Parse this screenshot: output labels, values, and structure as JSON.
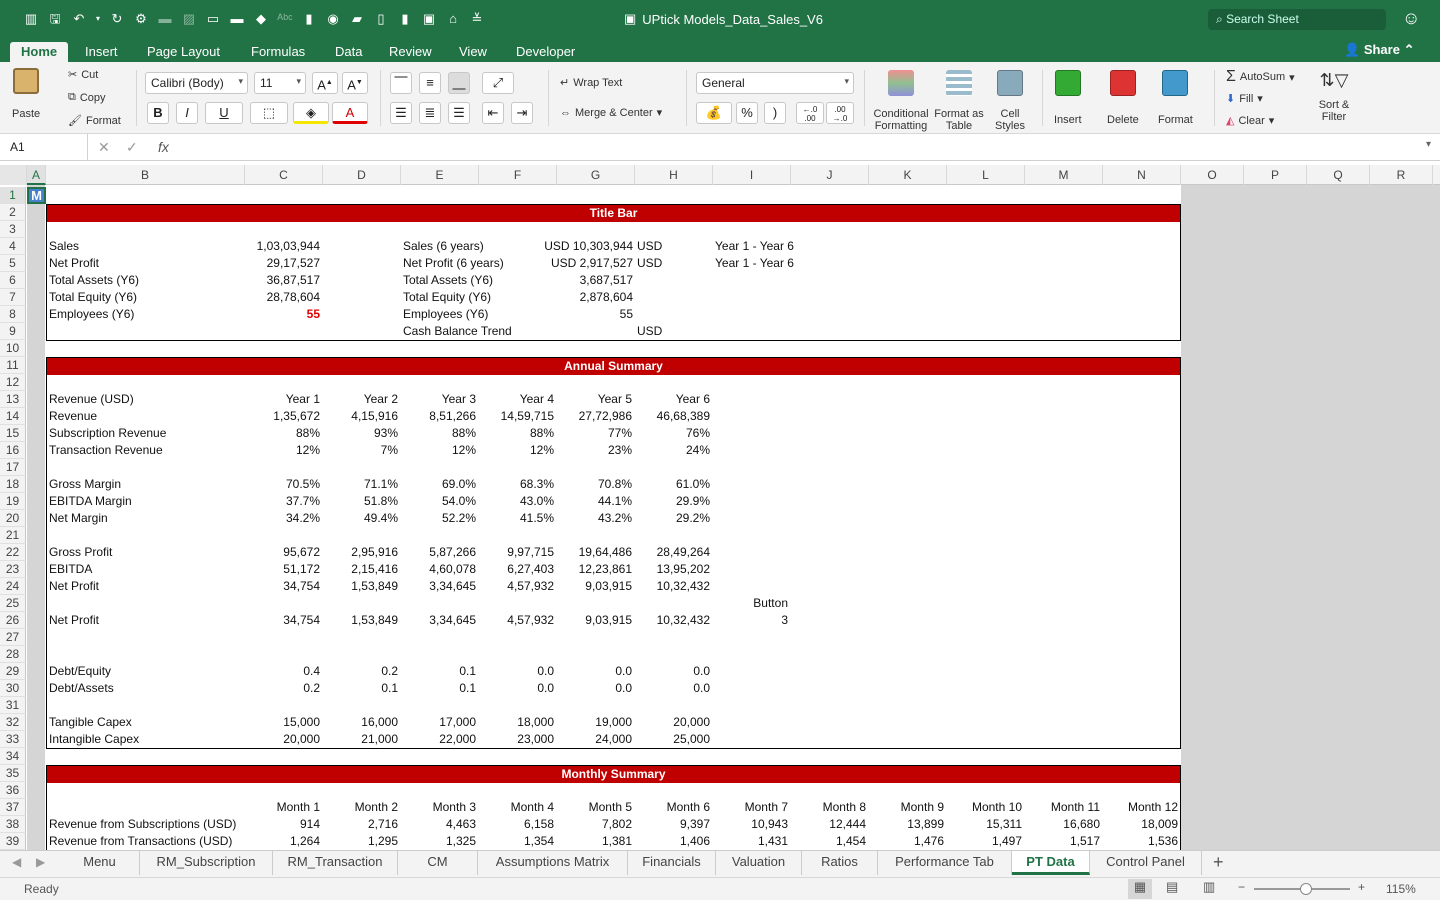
{
  "app": {
    "doc_title": "UPtick Models_Data_Sales_V6",
    "search_placeholder": "Search Sheet",
    "share_label": "Share"
  },
  "ribbon_tabs": [
    "Home",
    "Insert",
    "Page Layout",
    "Formulas",
    "Data",
    "Review",
    "View",
    "Developer"
  ],
  "ribbon": {
    "paste": "Paste",
    "cut": "Cut",
    "copy": "Copy",
    "format": "Format",
    "font_name": "Calibri (Body)",
    "font_size": "11",
    "bold": "B",
    "italic": "I",
    "underline": "U",
    "wrap_text": "Wrap Text",
    "merge_center": "Merge & Center",
    "number_format": "General",
    "percent": "%",
    "comma": ")",
    "inc_decimal": "←.0\n.00",
    "dec_decimal": ".00\n→.0",
    "conditional_formatting": "Conditional Formatting",
    "format_as_table": "Format as Table",
    "cell_styles": "Cell Styles",
    "insert": "Insert",
    "delete": "Delete",
    "format_cells": "Format",
    "autosum": "AutoSum",
    "fill": "Fill",
    "clear": "Clear",
    "sort_filter": "Sort & Filter"
  },
  "formula_bar": {
    "name_box": "A1",
    "fx": "fx",
    "value": ""
  },
  "columns": [
    "A",
    "B",
    "C",
    "D",
    "E",
    "F",
    "G",
    "H",
    "I",
    "J",
    "K",
    "L",
    "M",
    "N",
    "O",
    "P",
    "Q",
    "R"
  ],
  "rows": [
    "1",
    "2",
    "3",
    "4",
    "5",
    "6",
    "7",
    "8",
    "9",
    "10",
    "11",
    "12",
    "13",
    "14",
    "15",
    "16",
    "17",
    "18",
    "19",
    "20",
    "21",
    "22",
    "23",
    "24",
    "25",
    "26",
    "27",
    "28",
    "29",
    "30",
    "31",
    "32",
    "33",
    "34",
    "35",
    "36",
    "37",
    "38",
    "39"
  ],
  "a1_value": "M",
  "title_block": {
    "header": "Title Bar",
    "left": [
      [
        "Sales",
        "1,03,03,944"
      ],
      [
        "Net Profit",
        "29,17,527"
      ],
      [
        "Total Assets (Y6)",
        "36,87,517"
      ],
      [
        "Total Equity (Y6)",
        "28,78,604"
      ],
      [
        "Employees (Y6)",
        "55"
      ]
    ],
    "mid": [
      [
        "Sales (6 years)",
        "USD 10,303,944",
        "USD"
      ],
      [
        "Net Profit (6 years)",
        "USD 2,917,527",
        "USD"
      ],
      [
        "Total Assets (Y6)",
        "3,687,517",
        ""
      ],
      [
        "Total Equity (Y6)",
        "2,878,604",
        ""
      ],
      [
        "Employees (Y6)",
        "55",
        ""
      ],
      [
        "Cash Balance Trend",
        "",
        "USD"
      ]
    ],
    "right": [
      "Year 1 - Year 6",
      "Year 1 - Year 6"
    ]
  },
  "annual": {
    "header": "Annual Summary",
    "col_label": "Revenue (USD)",
    "years": [
      "Year 1",
      "Year 2",
      "Year 3",
      "Year 4",
      "Year 5",
      "Year 6"
    ],
    "rows": [
      {
        "r": 14,
        "label": "Revenue",
        "v": [
          "1,35,672",
          "4,15,916",
          "8,51,266",
          "14,59,715",
          "27,72,986",
          "46,68,389"
        ]
      },
      {
        "r": 15,
        "label": "Subscription Revenue",
        "v": [
          "88%",
          "93%",
          "88%",
          "88%",
          "77%",
          "76%"
        ]
      },
      {
        "r": 16,
        "label": "Transaction Revenue",
        "v": [
          "12%",
          "7%",
          "12%",
          "12%",
          "23%",
          "24%"
        ]
      },
      {
        "r": 18,
        "label": "Gross Margin",
        "v": [
          "70.5%",
          "71.1%",
          "69.0%",
          "68.3%",
          "70.8%",
          "61.0%"
        ]
      },
      {
        "r": 19,
        "label": "EBITDA Margin",
        "v": [
          "37.7%",
          "51.8%",
          "54.0%",
          "43.0%",
          "44.1%",
          "29.9%"
        ]
      },
      {
        "r": 20,
        "label": "Net Margin",
        "v": [
          "34.2%",
          "49.4%",
          "52.2%",
          "41.5%",
          "43.2%",
          "29.2%"
        ]
      },
      {
        "r": 22,
        "label": "Gross Profit",
        "v": [
          "95,672",
          "2,95,916",
          "5,87,266",
          "9,97,715",
          "19,64,486",
          "28,49,264"
        ]
      },
      {
        "r": 23,
        "label": "EBITDA",
        "v": [
          "51,172",
          "2,15,416",
          "4,60,078",
          "6,27,403",
          "12,23,861",
          "13,95,202"
        ]
      },
      {
        "r": 24,
        "label": "Net Profit",
        "v": [
          "34,754",
          "1,53,849",
          "3,34,645",
          "4,57,932",
          "9,03,915",
          "10,32,432"
        ]
      },
      {
        "r": 26,
        "label": "Net Profit",
        "v": [
          "34,754",
          "1,53,849",
          "3,34,645",
          "4,57,932",
          "9,03,915",
          "10,32,432"
        ]
      },
      {
        "r": 29,
        "label": "Debt/Equity",
        "v": [
          "0.4",
          "0.2",
          "0.1",
          "0.0",
          "0.0",
          "0.0"
        ]
      },
      {
        "r": 30,
        "label": "Debt/Assets",
        "v": [
          "0.2",
          "0.1",
          "0.1",
          "0.0",
          "0.0",
          "0.0"
        ]
      },
      {
        "r": 32,
        "label": "Tangible Capex",
        "v": [
          "15,000",
          "16,000",
          "17,000",
          "18,000",
          "19,000",
          "20,000"
        ]
      },
      {
        "r": 33,
        "label": "Intangible Capex",
        "v": [
          "20,000",
          "21,000",
          "22,000",
          "23,000",
          "24,000",
          "25,000"
        ]
      }
    ],
    "button_label": "Button",
    "button_value": "3"
  },
  "monthly": {
    "header": "Monthly Summary",
    "months": [
      "Month 1",
      "Month 2",
      "Month 3",
      "Month 4",
      "Month 5",
      "Month 6",
      "Month 7",
      "Month 8",
      "Month 9",
      "Month 10",
      "Month 11",
      "Month 12"
    ],
    "rows": [
      {
        "r": 38,
        "label": "Revenue from Subscriptions (USD)",
        "v": [
          "914",
          "2,716",
          "4,463",
          "6,158",
          "7,802",
          "9,397",
          "10,943",
          "12,444",
          "13,899",
          "15,311",
          "16,680",
          "18,009"
        ]
      },
      {
        "r": 39,
        "label": "Revenue from Transactions (USD)",
        "v": [
          "1,264",
          "1,295",
          "1,325",
          "1,354",
          "1,381",
          "1,406",
          "1,431",
          "1,454",
          "1,476",
          "1,497",
          "1,517",
          "1,536"
        ]
      }
    ]
  },
  "sheet_tabs": [
    "Menu",
    "RM_Subscription",
    "RM_Transaction",
    "CM",
    "Assumptions Matrix",
    "Financials",
    "Valuation",
    "Ratios",
    "Performance Tab",
    "PT Data",
    "Control Panel"
  ],
  "active_sheet": "PT Data",
  "status": {
    "ready": "Ready",
    "zoom": "115%"
  },
  "colors": {
    "excel_green": "#217346",
    "header_red": "#c00000"
  }
}
